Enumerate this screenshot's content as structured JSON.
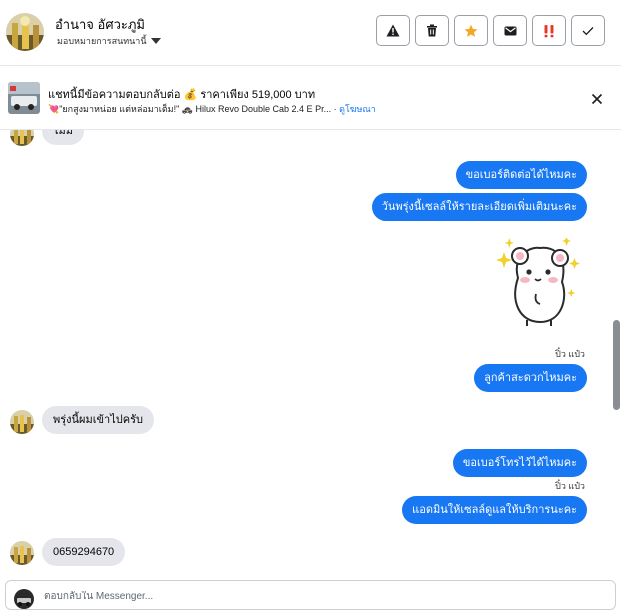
{
  "header": {
    "contact_name": "อำนาจ อัศวะภูมิ",
    "assign_label": "มอบหมายการสนทนานี้",
    "actions": [
      {
        "name": "warning-icon",
        "color": "#1c1e21"
      },
      {
        "name": "trash-icon",
        "color": "#1c1e21"
      },
      {
        "name": "star-icon",
        "color": "#f5a623"
      },
      {
        "name": "mail-icon",
        "color": "#1c1e21"
      },
      {
        "name": "important-icon",
        "color": "#e4392b"
      },
      {
        "name": "check-icon",
        "color": "#1c1e21"
      }
    ]
  },
  "banner": {
    "title": "แชทนี้มีข้อความตอบกลับต่อ 💰 ราคาเพียง 519,000 บาท",
    "subtitle": "💘\"ยกสูงมาหน่อย แต่หล่อมาเต็ม!\" 🚓 Hilux Revo Double Cab 2.4 E Pr...",
    "link": "ดูโฆษณา"
  },
  "messages": {
    "top_partial": "ไม่มี",
    "out_1": "ขอเบอร์ติดต่อได้ไหมคะ",
    "out_2": "วันพรุ่งนี้เซลล์ให้รายละเอียดเพิ่มเติมนะคะ",
    "sender_1": "ปิ๋ว แป๋ว",
    "out_3": "ลูกค้าสะดวกไหมคะ",
    "in_1": "พรุ่งนี้ผมเข้าไปครับ",
    "out_4": "ขอเบอร์โทรไว้ได้ไหมคะ",
    "sender_2": "ปิ๋ว แป๋ว",
    "out_5": "แอดมินให้เซลล์ดูแลให้บริการนะคะ",
    "in_2": "0659294670"
  },
  "composer": {
    "placeholder": "ตอบกลับใน Messenger..."
  },
  "colors": {
    "brand_blue": "#1877f2",
    "incoming_bubble": "#e4e6eb"
  }
}
